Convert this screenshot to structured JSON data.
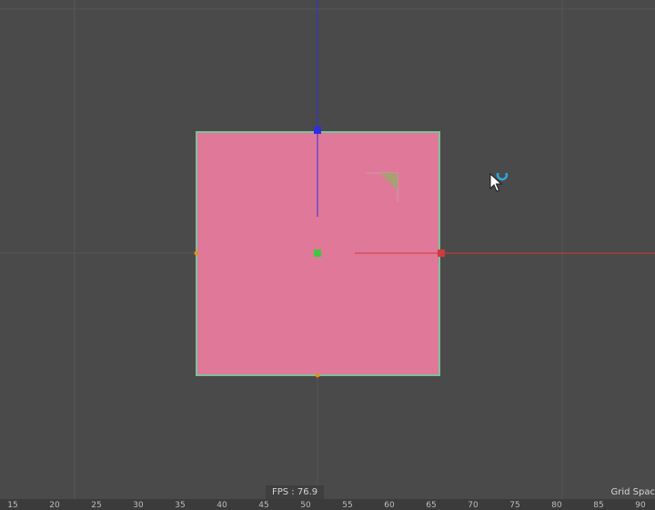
{
  "viewport": {
    "background_color": "#4a4a4a",
    "grid_color": "#555555"
  },
  "object": {
    "fill_color": "#e0789a",
    "edge_color": "#7fbf9a"
  },
  "gizmo": {
    "y_axis_color": "#2f2fe0",
    "x_axis_color": "#d03a3a",
    "pivot_color": "#3ec83e",
    "handle_color": "#e09020"
  },
  "hud": {
    "fps_text": "FPS : 76.9",
    "grid_text": "Grid Spac"
  },
  "ruler": {
    "ticks": [
      "15",
      "20",
      "25",
      "30",
      "35",
      "40",
      "45",
      "50",
      "55",
      "60",
      "65",
      "70",
      "75",
      "80",
      "85",
      "90"
    ]
  },
  "cursor": {
    "icon": "cursor-arrow-icon",
    "busy_icon": "busy-ring-icon",
    "busy_color": "#2fa5e0"
  }
}
